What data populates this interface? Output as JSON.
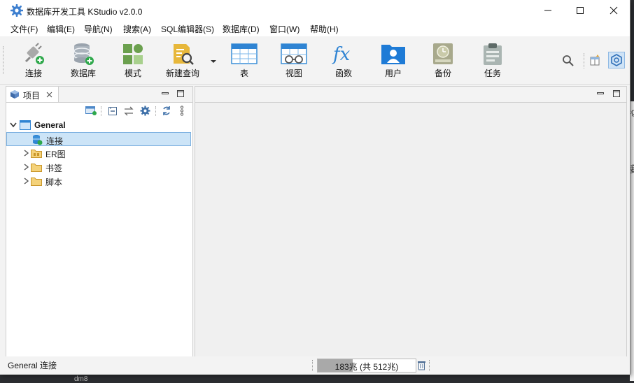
{
  "window": {
    "title": "数据库开发工具 KStudio v2.0.0"
  },
  "menu": [
    "文件(F)",
    "编辑(E)",
    "导航(N)",
    "搜索(A)",
    "SQL编辑器(S)",
    "数据库(D)",
    "窗口(W)",
    "帮助(H)"
  ],
  "toolbar": {
    "connect": "连接",
    "database": "数据库",
    "schema": "模式",
    "new_query": "新建查询",
    "table": "表",
    "view": "视图",
    "function": "函数",
    "user": "用户",
    "backup": "备份",
    "task": "任务"
  },
  "project_panel": {
    "tab_label": "项目",
    "root": "General",
    "items": [
      "连接",
      "ER图",
      "书签",
      "脚本"
    ]
  },
  "status": {
    "text": "General 连接",
    "memory": "183兆 (共 512兆)",
    "memory_used_fraction": 0.357
  },
  "background": {
    "partial_text_1": "cg",
    "partial_text_2": "接",
    "partial_text_3": "dm8"
  },
  "colors": {
    "accent": "#1e7bd6",
    "selection": "#cce4f7",
    "folder": "#e8b84a"
  }
}
